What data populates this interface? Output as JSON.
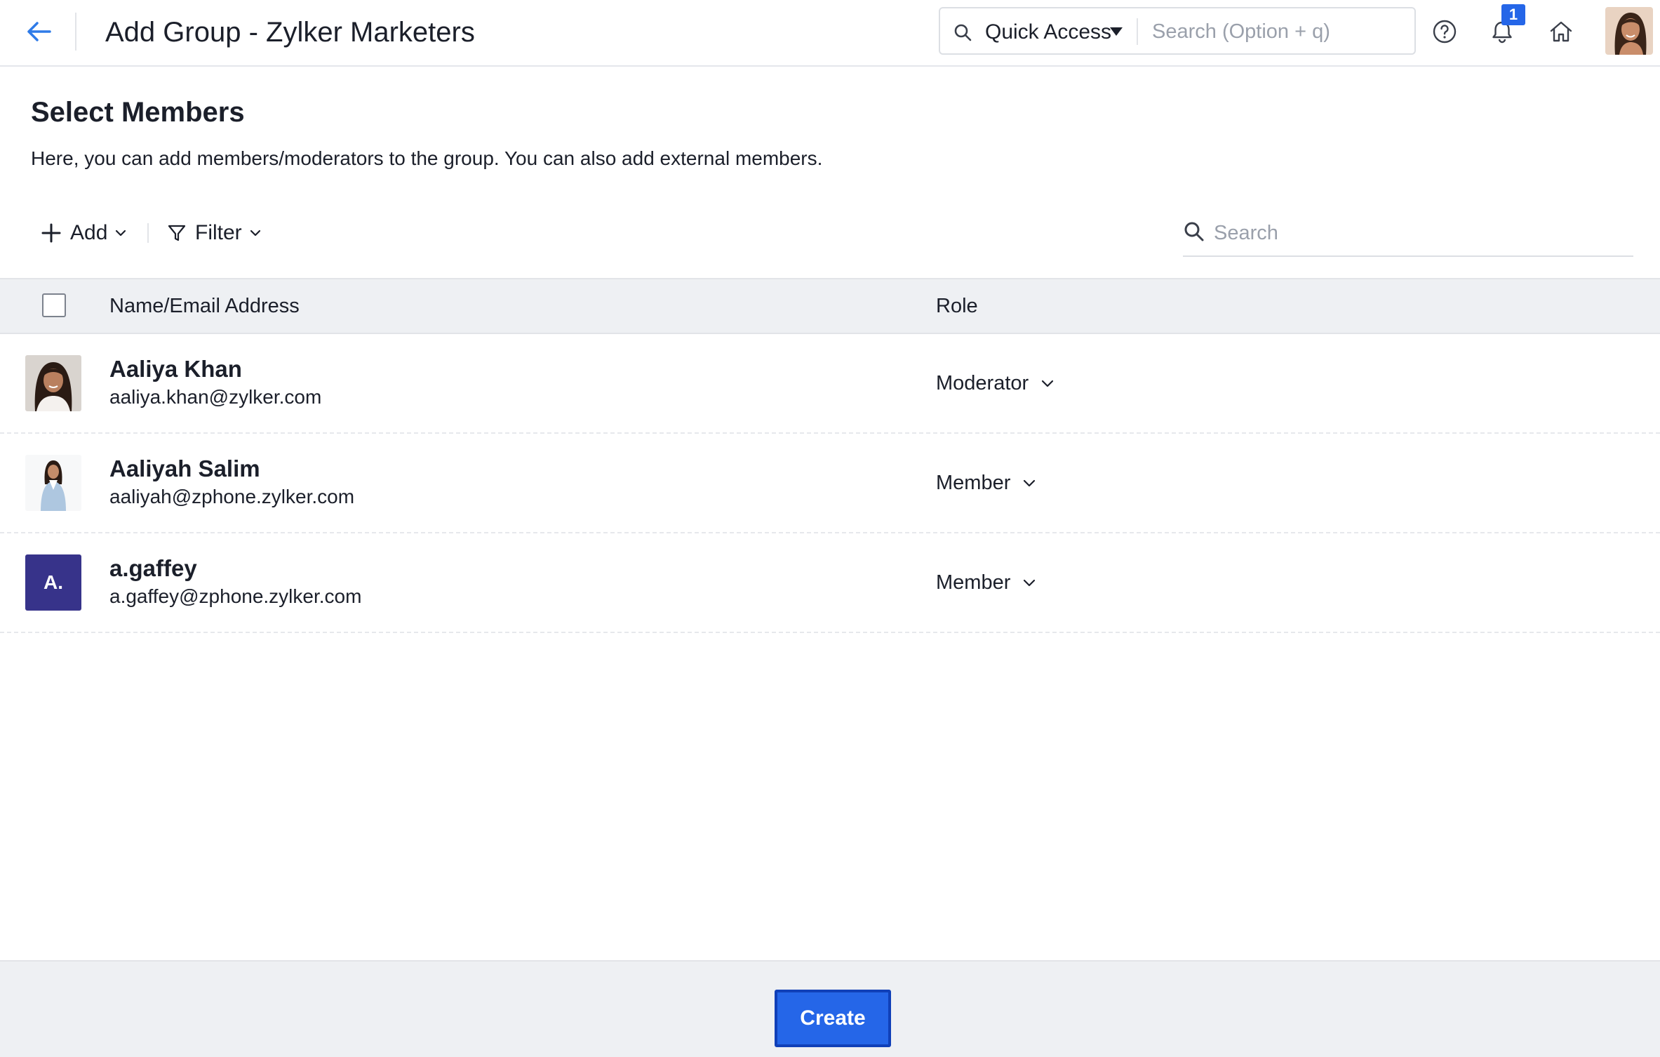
{
  "header": {
    "title": "Add Group - Zylker Marketers",
    "quick_access_label": "Quick Access",
    "search_placeholder": "Search (Option + q)",
    "notification_count": "1",
    "icons": [
      "back-arrow-icon",
      "search-icon",
      "help-icon",
      "bell-icon",
      "home-icon"
    ]
  },
  "section": {
    "title": "Select Members",
    "description": "Here, you can add members/moderators to the group. You can also add external members."
  },
  "toolbar": {
    "add_label": "Add",
    "filter_label": "Filter",
    "search_placeholder": "Search"
  },
  "table": {
    "columns": [
      "Name/Email Address",
      "Role"
    ],
    "rows": [
      {
        "name": "Aaliya Khan",
        "email": "aaliya.khan@zylker.com",
        "role": "Moderator",
        "avatar": "photo"
      },
      {
        "name": "Aaliyah Salim",
        "email": "aaliyah@zphone.zylker.com",
        "role": "Member",
        "avatar": "photo"
      },
      {
        "name": "a.gaffey",
        "email": "a.gaffey@zphone.zylker.com",
        "role": "Member",
        "avatar": "initials",
        "initials": "A."
      }
    ]
  },
  "footer": {
    "create_label": "Create"
  },
  "colors": {
    "accent": "#2566e8",
    "initials_avatar": "#37338a",
    "table_header_bg": "#eef0f3"
  }
}
